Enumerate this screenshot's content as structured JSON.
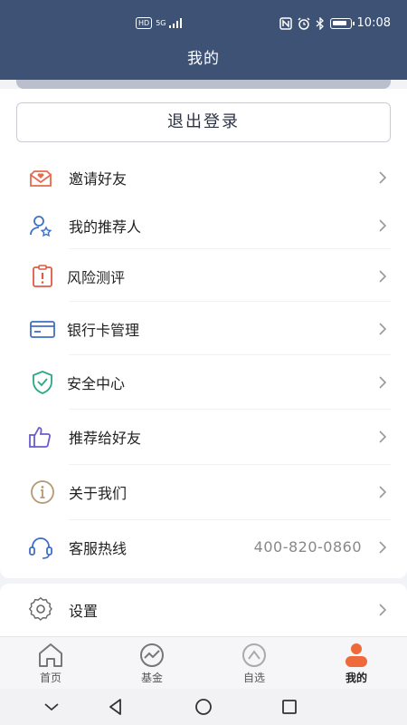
{
  "status_bar": {
    "network_badge": "HD",
    "signal_label": "5G",
    "time": "10:08"
  },
  "header": {
    "title": "我的"
  },
  "logout": {
    "label": "退出登录"
  },
  "menu": {
    "items": [
      {
        "id": "invite",
        "label": "邀请好友",
        "icon": "envelope-heart-icon"
      },
      {
        "id": "referrer",
        "label": "我的推荐人",
        "icon": "person-star-icon"
      },
      {
        "id": "risk",
        "label": "风险测评",
        "icon": "clipboard-alert-icon"
      },
      {
        "id": "bankcard",
        "label": "银行卡管理",
        "icon": "credit-card-icon"
      },
      {
        "id": "security",
        "label": "安全中心",
        "icon": "shield-check-icon"
      },
      {
        "id": "recommend",
        "label": "推荐给好友",
        "icon": "thumbs-up-icon"
      },
      {
        "id": "about",
        "label": "关于我们",
        "icon": "info-icon"
      },
      {
        "id": "service",
        "label": "客服热线",
        "value": "400-820-0860",
        "icon": "headset-icon"
      }
    ],
    "settings": {
      "label": "设置",
      "icon": "gear-icon"
    }
  },
  "tabs": [
    {
      "label": "首页",
      "icon": "home-icon"
    },
    {
      "label": "基金",
      "icon": "fund-chart-icon"
    },
    {
      "label": "自选",
      "icon": "watchlist-icon"
    },
    {
      "label": "我的",
      "icon": "profile-icon",
      "active": true
    }
  ],
  "colors": {
    "header_bg": "#3d5275",
    "accent_orange": "#ef6a3a",
    "icon_red": "#e86a4f",
    "icon_blue": "#3f6fc6",
    "icon_green": "#2aa888",
    "icon_purple": "#6a5ccf",
    "icon_tan": "#b39a72"
  }
}
